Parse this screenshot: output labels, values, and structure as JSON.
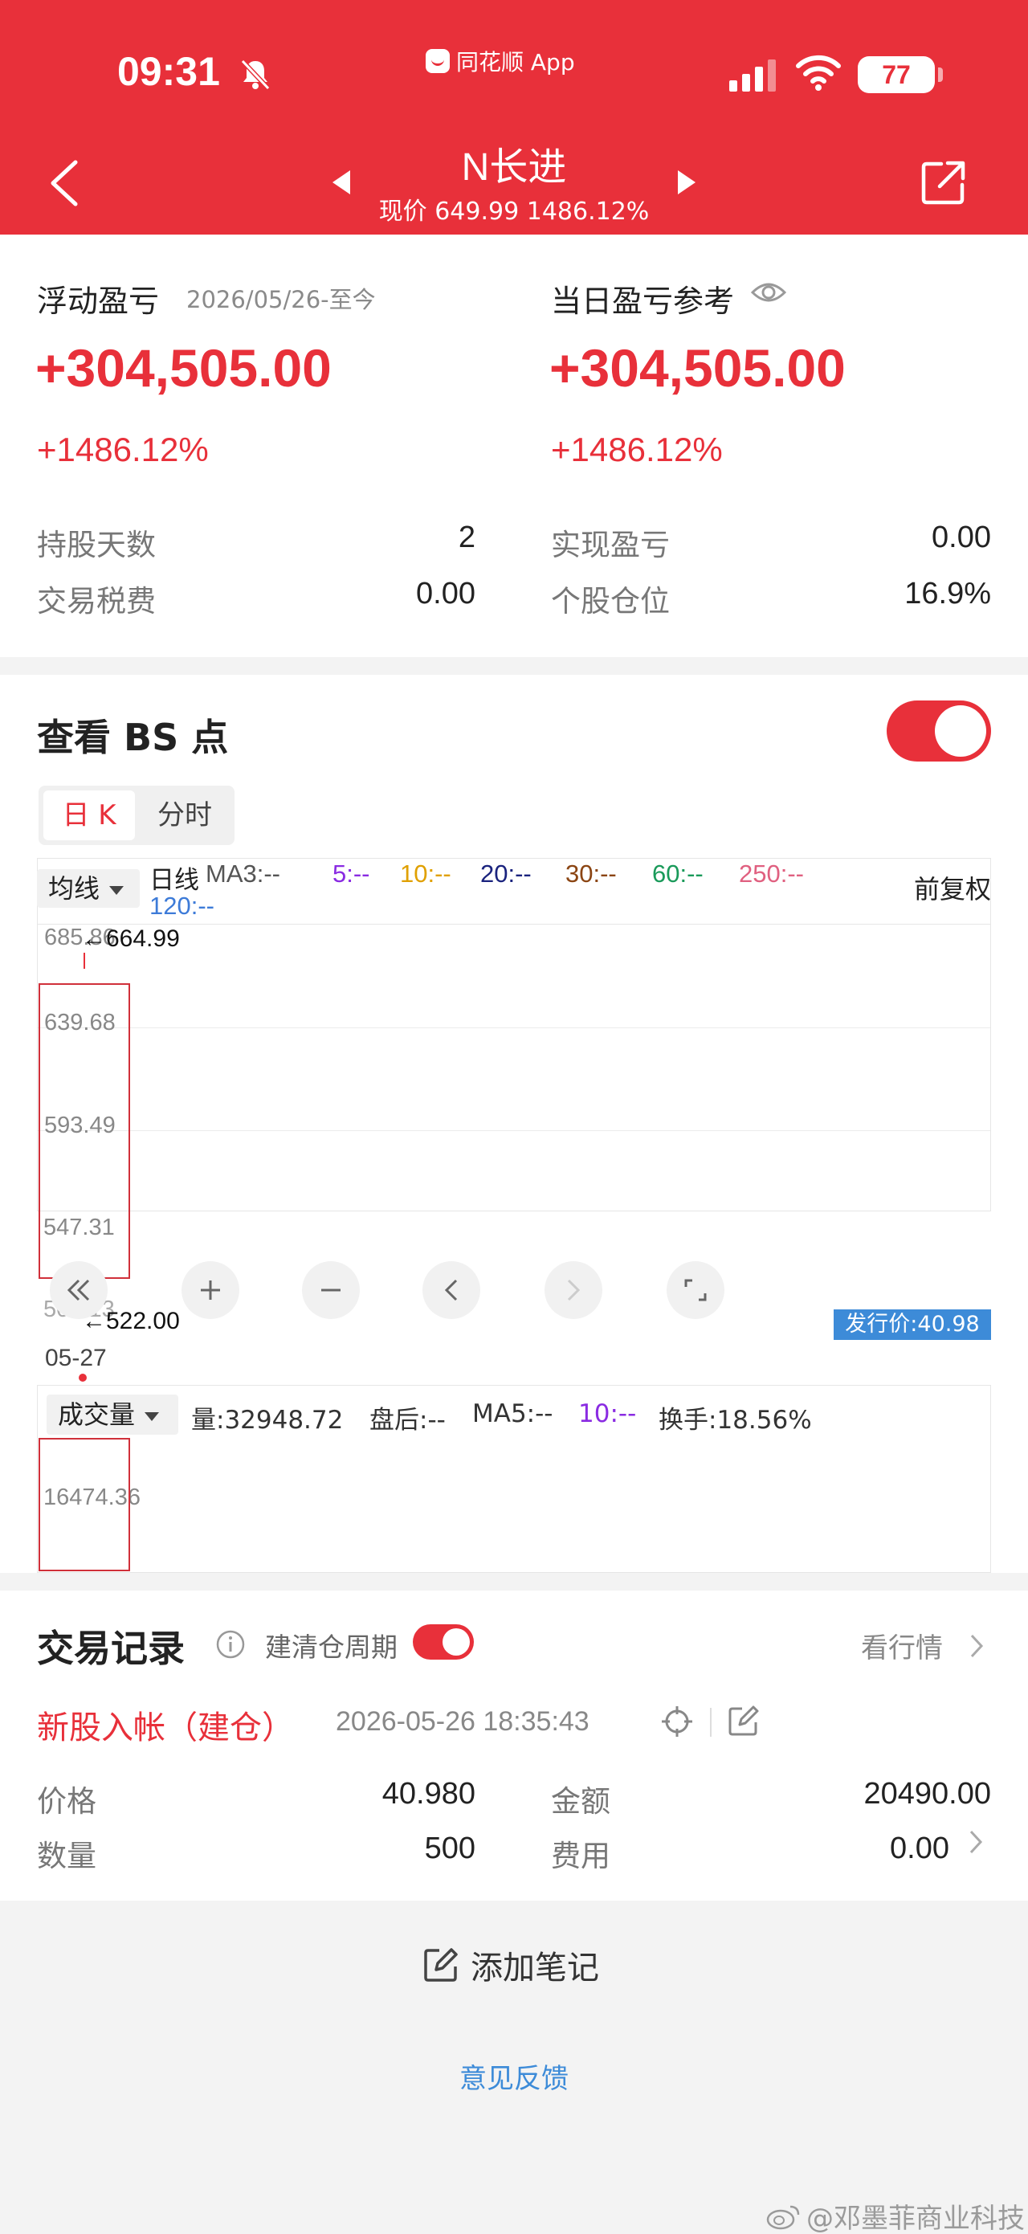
{
  "status_bar": {
    "time": "09:31",
    "source_app": "同花顺 App",
    "battery": "77"
  },
  "header": {
    "stock_name": "N长进",
    "price_line": "现价 649.99 1486.12%"
  },
  "summary": {
    "floating_label": "浮动盈亏",
    "floating_date": "2026/05/26-至今",
    "floating_amount": "+304,505.00",
    "floating_pct": "+1486.12%",
    "daily_label": "当日盈亏参考",
    "daily_amount": "+304,505.00",
    "daily_pct": "+1486.12%",
    "stats": [
      {
        "label": "持股天数",
        "value": "2"
      },
      {
        "label": "实现盈亏",
        "value": "0.00"
      },
      {
        "label": "交易税费",
        "value": "0.00"
      },
      {
        "label": "个股仓位",
        "value": "16.9%"
      }
    ]
  },
  "chart": {
    "title": "查看 BS 点",
    "tabs": [
      "日 K",
      "分时"
    ],
    "ma_select": "均线",
    "ma_items": [
      {
        "text": "日线",
        "color": "#222222"
      },
      {
        "text": "MA3:--",
        "color": "#555555"
      },
      {
        "text": "5:--",
        "color": "#8a2be2"
      },
      {
        "text": "10:--",
        "color": "#e0a000"
      },
      {
        "text": "20:--",
        "color": "#1a237e"
      },
      {
        "text": "30:--",
        "color": "#8b4513"
      },
      {
        "text": "60:--",
        "color": "#1a9a5a"
      },
      {
        "text": "250:--",
        "color": "#e06080"
      },
      {
        "text": "120:--",
        "color": "#3d7bd8"
      }
    ],
    "adjust_label": "前复权",
    "y_ticks": [
      "685.86",
      "639.68",
      "593.49",
      "547.31",
      "501.13"
    ],
    "high_annotation": "←664.99",
    "low_annotation": "←522.00",
    "issue_price": "发行价:40.98",
    "date_tick": "05-27",
    "volume": {
      "select": "成交量",
      "items": [
        {
          "text": "量:32948.72",
          "color": "#333333"
        },
        {
          "text": "盘后:--",
          "color": "#333333"
        },
        {
          "text": "MA5:--",
          "color": "#333333"
        },
        {
          "text": "10:--",
          "color": "#8a2be2"
        },
        {
          "text": "换手:18.56%",
          "color": "#333333"
        }
      ],
      "y_tick": "16474.36"
    }
  },
  "trades": {
    "title": "交易记录",
    "cycle_label": "建清仓周期",
    "view_market": "看行情",
    "record": {
      "type": "新股入帐（建仓）",
      "time": "2026-05-26 18:35:43",
      "fields": [
        {
          "label": "价格",
          "value": "40.980"
        },
        {
          "label": "金额",
          "value": "20490.00"
        },
        {
          "label": "数量",
          "value": "500"
        },
        {
          "label": "费用",
          "value": "0.00"
        }
      ]
    }
  },
  "footer": {
    "add_note": "添加笔记",
    "feedback": "意见反馈",
    "watermark": "@邓墨菲商业科技"
  },
  "colors": {
    "brand_red": "#e8303a",
    "link_blue": "#3d8bd8"
  }
}
